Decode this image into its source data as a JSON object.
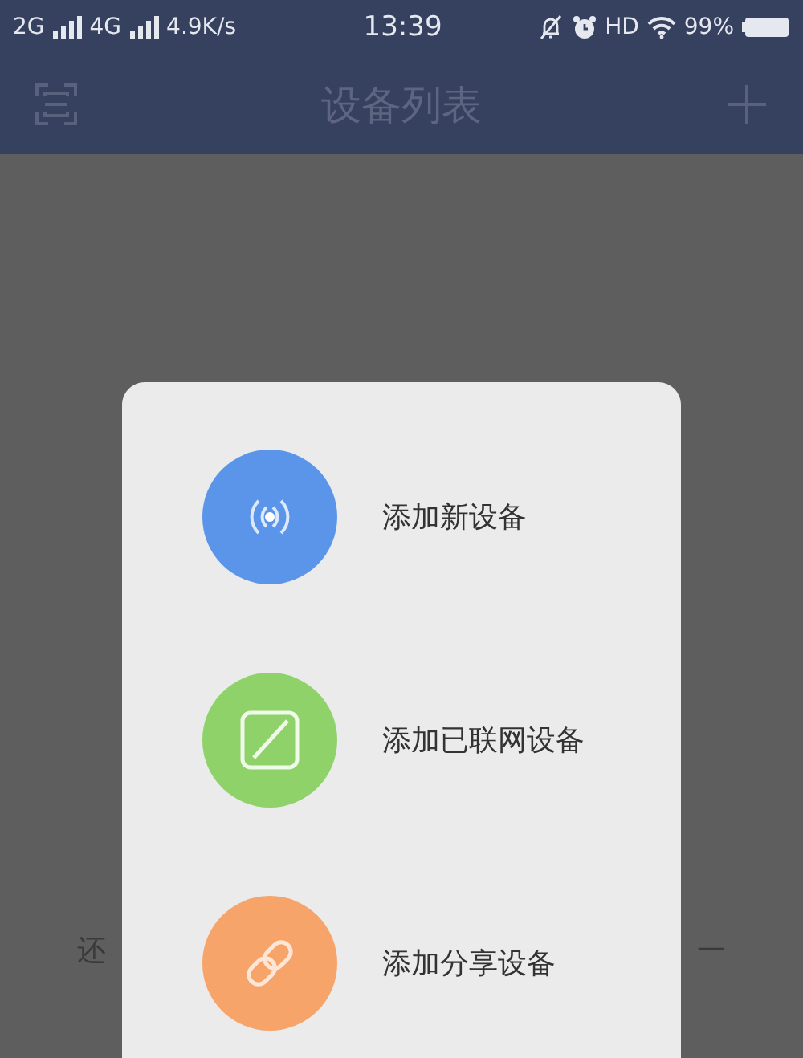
{
  "status_bar": {
    "networks": [
      {
        "label": "2G"
      },
      {
        "label": "4G"
      }
    ],
    "speed": "4.9K/s",
    "time": "13:39",
    "hd": "HD",
    "battery": "99%"
  },
  "header": {
    "title": "设备列表"
  },
  "background": {
    "text_left": "还",
    "text_right": "一"
  },
  "menu": {
    "items": [
      {
        "kind": "wireless",
        "label": "添加新设备",
        "color": "#5b95ea"
      },
      {
        "kind": "edit",
        "label": "添加已联网设备",
        "color": "#8fd26a"
      },
      {
        "kind": "link",
        "label": "添加分享设备",
        "color": "#f7a46a"
      }
    ]
  }
}
